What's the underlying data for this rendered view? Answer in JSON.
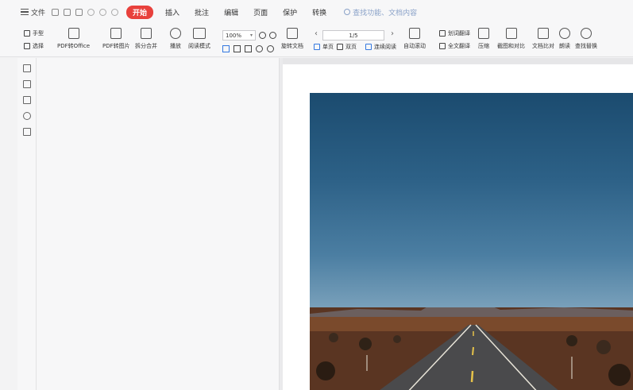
{
  "menubar": {
    "file_label": "文件",
    "tabs": [
      {
        "label": "开始",
        "active": true
      },
      {
        "label": "插入",
        "active": false
      },
      {
        "label": "批注",
        "active": false
      },
      {
        "label": "编辑",
        "active": false
      },
      {
        "label": "页面",
        "active": false
      },
      {
        "label": "保护",
        "active": false
      },
      {
        "label": "转换",
        "active": false
      }
    ],
    "search_label": "查找功能、文档内容"
  },
  "ribbon": {
    "hand_tool": "手型",
    "select_tool": "选择",
    "pdf_to_office": "PDF转Office",
    "pdf_to_image": "PDF转图片",
    "split_merge": "拆分合并",
    "play": "播放",
    "read_mode": "阅读模式",
    "zoom_value": "100%",
    "rotate_doc": "旋转文档",
    "single_page": "单页",
    "double_page": "双页",
    "continuous_read": "连续阅读",
    "auto_scroll": "自动滚动",
    "page_indicator": "1/5",
    "word_translate": "划词翻译",
    "full_translate": "全文翻译",
    "compress": "压缩",
    "screenshot_compare": "截图和对比",
    "doc_compare": "文档比对",
    "read_aloud": "朗读",
    "find_replace": "查找替换"
  },
  "colors": {
    "accent": "#e8413c",
    "blue_active": "#3478e0"
  }
}
